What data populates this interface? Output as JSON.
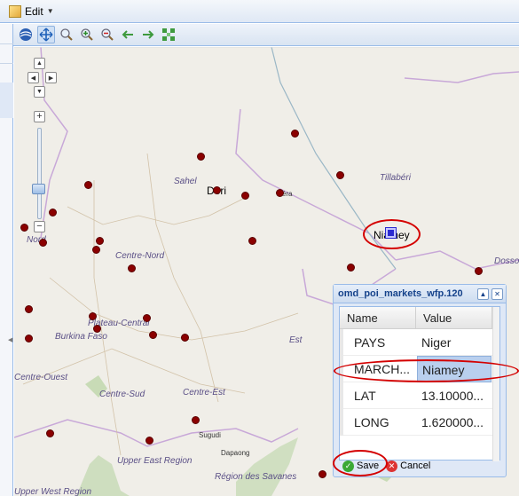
{
  "toolbar": {
    "edit_label": "Edit",
    "tools": [
      {
        "name": "globe-icon"
      },
      {
        "name": "pan-icon",
        "active": true
      },
      {
        "name": "zoom-icon"
      },
      {
        "name": "zoom-in-icon"
      },
      {
        "name": "zoom-out-icon"
      },
      {
        "name": "back-arrow-icon"
      },
      {
        "name": "forward-arrow-icon"
      },
      {
        "name": "full-extent-icon"
      }
    ]
  },
  "map": {
    "labels": {
      "sahel": "Sahel",
      "dori": "Dori",
      "tera": "Téra",
      "tillaberi": "Tillabéri",
      "niamey": "Niamey",
      "dosso": "Dosso",
      "nord": "Nord",
      "centre_nord": "Centre-Nord",
      "plateau_central": "Plateau-Central",
      "burkina_faso": "Burkina Faso",
      "centre_ouest": "Centre-Ouest",
      "centre_sud": "Centre-Sud",
      "centre_est": "Centre-Est",
      "est": "Est",
      "sugudi": "Sugudi",
      "dapaong": "Dapaong",
      "upper_east": "Upper East Region",
      "region_savanes": "Région des Savanes",
      "upper_west": "Upper West Region"
    },
    "controls": {
      "zoom_in": "+",
      "zoom_out": "−",
      "pan_up": "▲",
      "pan_down": "▼",
      "pan_left": "◀",
      "pan_right": "▶"
    },
    "colors": {
      "marker": "#8b0000",
      "selected": "#2a2ad0",
      "highlight_ring": "#d40000"
    }
  },
  "popup": {
    "title": "omd_poi_markets_wfp.120",
    "columns": [
      "Name",
      "Value"
    ],
    "rows": [
      {
        "name": "PAYS",
        "value": "Niger"
      },
      {
        "name": "MARCH...",
        "value": "Niamey"
      },
      {
        "name": "LAT",
        "value": "13.10000..."
      },
      {
        "name": "LONG",
        "value": "1.620000..."
      }
    ],
    "save_label": "Save",
    "cancel_label": "Cancel"
  }
}
